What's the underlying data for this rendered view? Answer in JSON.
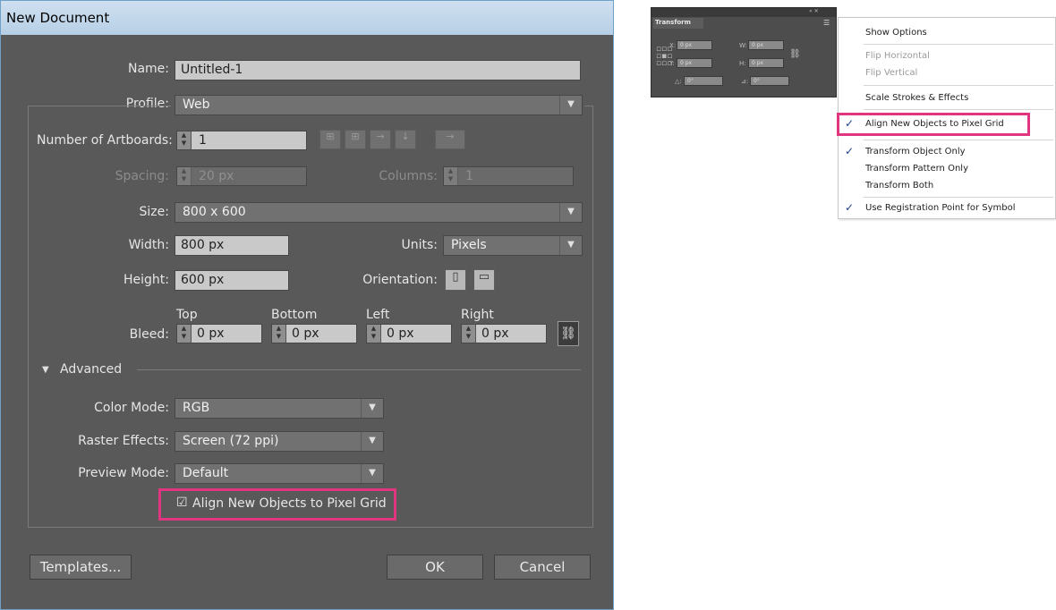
{
  "dialog": {
    "title": "New Document",
    "name": {
      "label": "Name:",
      "value": "Untitled-1"
    },
    "profile": {
      "label": "Profile:",
      "value": "Web"
    },
    "artboards": {
      "label": "Number of Artboards:",
      "value": "1"
    },
    "spacing": {
      "label": "Spacing:",
      "value": "20 px"
    },
    "columns": {
      "label": "Columns:",
      "value": "1"
    },
    "size": {
      "label": "Size:",
      "value": "800 x 600"
    },
    "width": {
      "label": "Width:",
      "value": "800 px"
    },
    "units": {
      "label": "Units:",
      "value": "Pixels"
    },
    "height": {
      "label": "Height:",
      "value": "600 px"
    },
    "orientation": {
      "label": "Orientation:"
    },
    "bleed": {
      "label": "Bleed:",
      "top": {
        "label": "Top",
        "value": "0 px"
      },
      "bottom": {
        "label": "Bottom",
        "value": "0 px"
      },
      "left": {
        "label": "Left",
        "value": "0 px"
      },
      "right": {
        "label": "Right",
        "value": "0 px"
      }
    },
    "advanced": {
      "label": "Advanced"
    },
    "color_mode": {
      "label": "Color Mode:",
      "value": "RGB"
    },
    "raster_effects": {
      "label": "Raster Effects:",
      "value": "Screen (72 ppi)"
    },
    "preview_mode": {
      "label": "Preview Mode:",
      "value": "Default"
    },
    "align_pixel_grid": {
      "label": "Align New Objects to Pixel Grid",
      "checked": true
    },
    "templates_button": "Templates...",
    "ok_button": "OK",
    "cancel_button": "Cancel"
  },
  "transform_panel": {
    "title": "Transform",
    "x": {
      "label": "X:",
      "value": "0 px"
    },
    "y": {
      "label": "Y:",
      "value": "0 px"
    },
    "w": {
      "label": "W:",
      "value": "0 px"
    },
    "h": {
      "label": "H:",
      "value": "0 px"
    },
    "angle": {
      "label": "△:",
      "value": "0°"
    },
    "shear": {
      "label": "⊿:",
      "value": "0°"
    }
  },
  "menu": {
    "items": [
      {
        "label": "Show Options",
        "checked": false,
        "disabled": false
      },
      {
        "label": "Flip Horizontal",
        "checked": false,
        "disabled": true
      },
      {
        "label": "Flip Vertical",
        "checked": false,
        "disabled": true
      },
      {
        "label": "Scale Strokes & Effects",
        "checked": false,
        "disabled": false
      },
      {
        "label": "Align New Objects to Pixel Grid",
        "checked": true,
        "disabled": false
      },
      {
        "label": "Transform Object Only",
        "checked": true,
        "disabled": false
      },
      {
        "label": "Transform Pattern Only",
        "checked": false,
        "disabled": false
      },
      {
        "label": "Transform Both",
        "checked": false,
        "disabled": false
      },
      {
        "label": "Use Registration Point for Symbol",
        "checked": true,
        "disabled": false
      }
    ],
    "check_glyph": "✓"
  },
  "colors": {
    "highlight": "#e0357f",
    "dialog_bg": "#595959",
    "menu_check": "#1c3f8a"
  }
}
